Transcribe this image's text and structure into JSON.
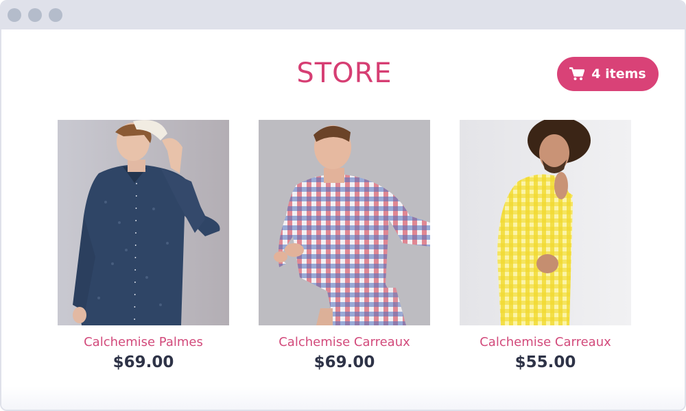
{
  "store": {
    "title": "STORE",
    "cart": {
      "label": "4 items",
      "icon": "cart-icon"
    },
    "accent_color": "#d94277"
  },
  "products": [
    {
      "name": "Calchemise Palmes",
      "price": "$69.00"
    },
    {
      "name": "Calchemise Carreaux",
      "price": "$69.00"
    },
    {
      "name": "Calchemise Carreaux",
      "price": "$55.00"
    }
  ]
}
